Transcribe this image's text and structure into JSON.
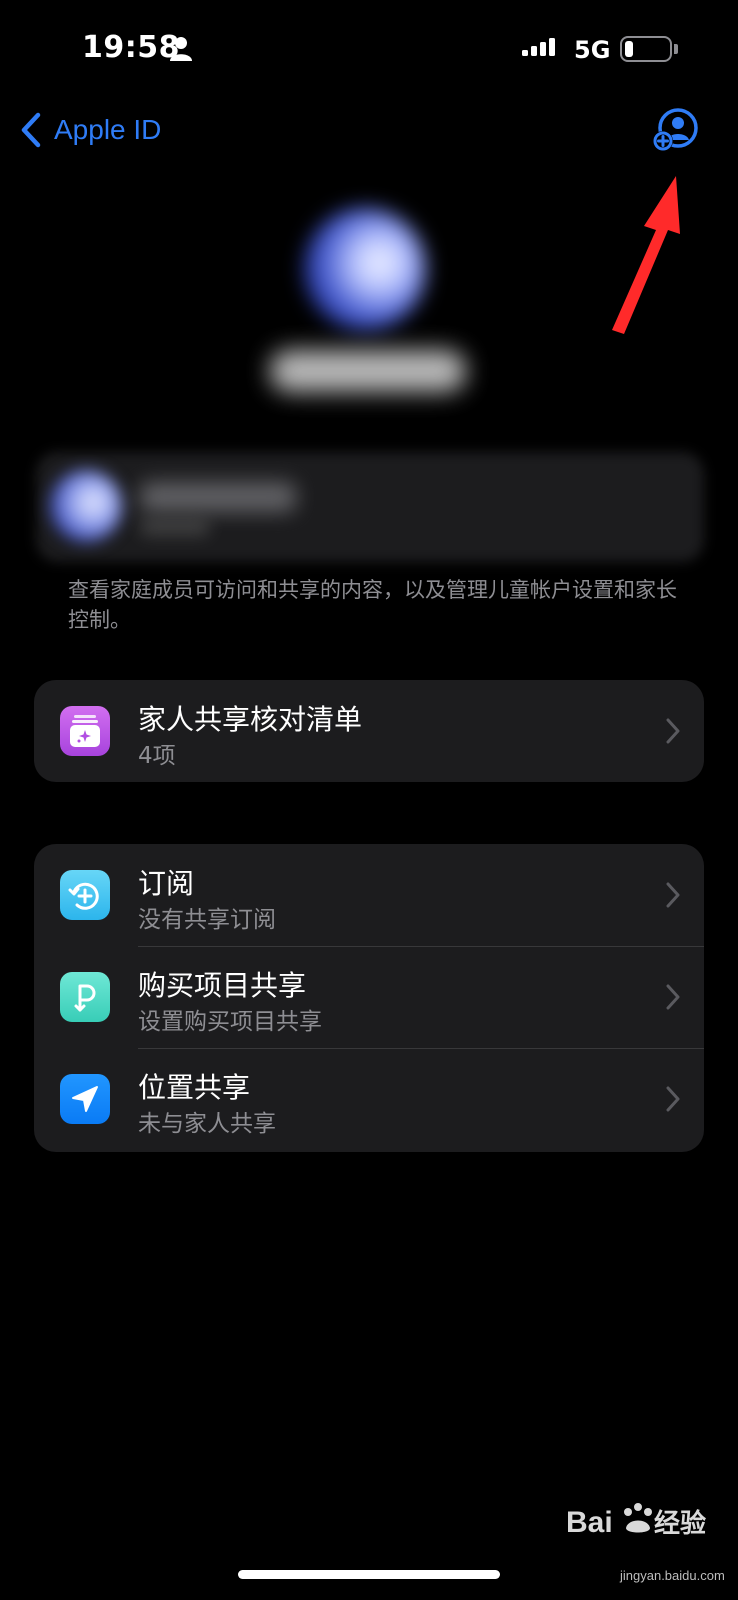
{
  "status_bar": {
    "time": "19:58",
    "network": "5G",
    "battery_level": 0.2
  },
  "nav": {
    "back_label": "Apple ID",
    "add_member_icon": "person-add-icon",
    "accent_color": "#2f7cf6"
  },
  "footnote": "查看家庭成员可访问和共享的内容，以及管理儿童帐户设置和家长控制。",
  "checklist_group": {
    "items": [
      {
        "title": "家人共享核对清单",
        "subtitle": "4项",
        "icon": "checklist-icon",
        "icon_color": "#c05ae8"
      }
    ]
  },
  "features_group": {
    "items": [
      {
        "title": "订阅",
        "subtitle": "没有共享订阅",
        "icon": "subscription-icon",
        "icon_color": "#4ec5f2"
      },
      {
        "title": "购买项目共享",
        "subtitle": "设置购买项目共享",
        "icon": "purchase-sharing-icon",
        "icon_color": "#4fdcc6"
      },
      {
        "title": "位置共享",
        "subtitle": "未与家人共享",
        "icon": "location-arrow-icon",
        "icon_color": "#0a84ff"
      }
    ]
  },
  "watermark": {
    "brand": "Bai du 经验",
    "url": "jingyan.baidu.com"
  }
}
